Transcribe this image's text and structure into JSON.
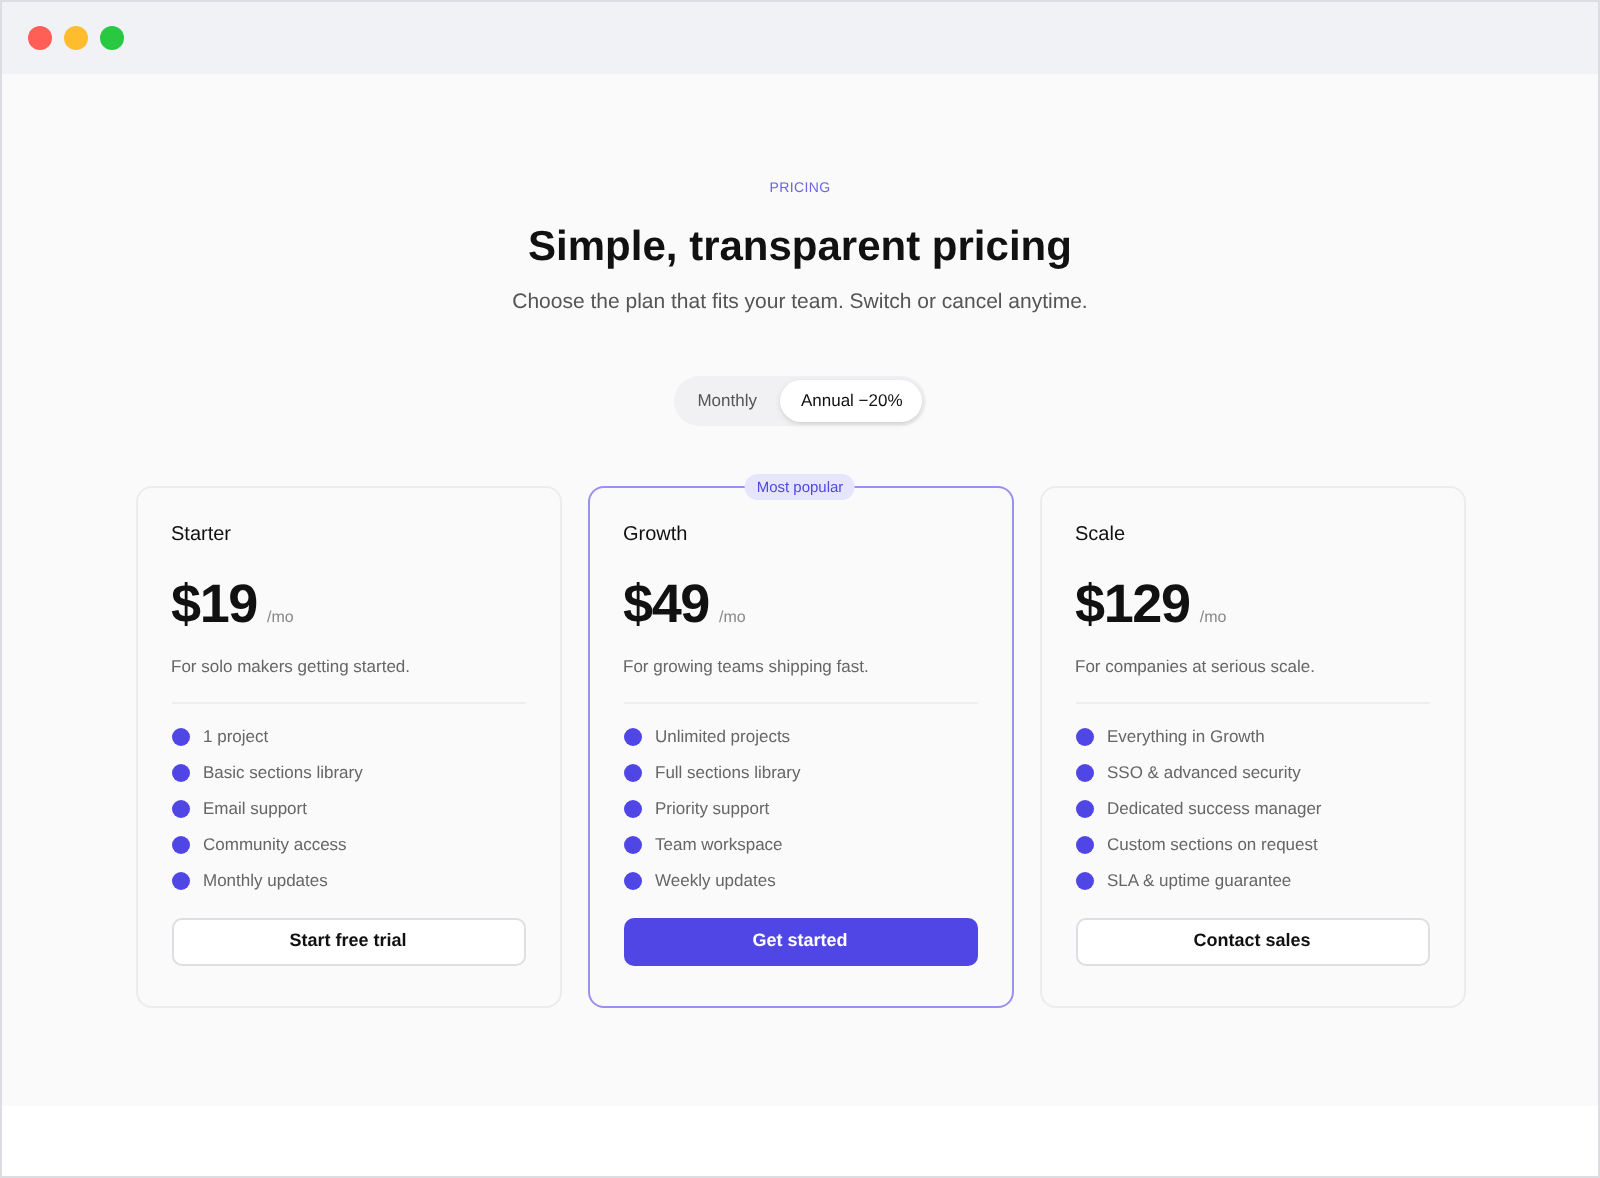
{
  "eyebrow": "PRICING",
  "title": "Simple, transparent pricing",
  "subtitle": "Choose the plan that fits your team. Switch or cancel anytime.",
  "billing_toggle": [
    {
      "label": "Monthly",
      "selected": false
    },
    {
      "label": "Annual −20%",
      "selected": true
    }
  ],
  "plans": [
    {
      "name": "Starter",
      "price": "$19",
      "period": "/mo",
      "description": "For solo makers getting started.",
      "featured": false,
      "features": [
        "1 project",
        "Basic sections library",
        "Email support",
        "Community access",
        "Monthly updates"
      ],
      "button": {
        "label": "Start free trial",
        "kind": "secondary"
      }
    },
    {
      "name": "Growth",
      "badge": "Most popular",
      "price": "$49",
      "period": "/mo",
      "description": "For growing teams shipping fast.",
      "featured": true,
      "features": [
        "Unlimited projects",
        "Full sections library",
        "Priority support",
        "Team workspace",
        "Weekly updates"
      ],
      "button": {
        "label": "Get started",
        "kind": "primary"
      }
    },
    {
      "name": "Scale",
      "price": "$129",
      "period": "/mo",
      "description": "For companies at serious scale.",
      "featured": false,
      "features": [
        "Everything in Growth",
        "SSO & advanced security",
        "Dedicated success manager",
        "Custom sections on request",
        "SLA & uptime guarantee"
      ],
      "button": {
        "label": "Contact sales",
        "kind": "secondary"
      }
    }
  ]
}
